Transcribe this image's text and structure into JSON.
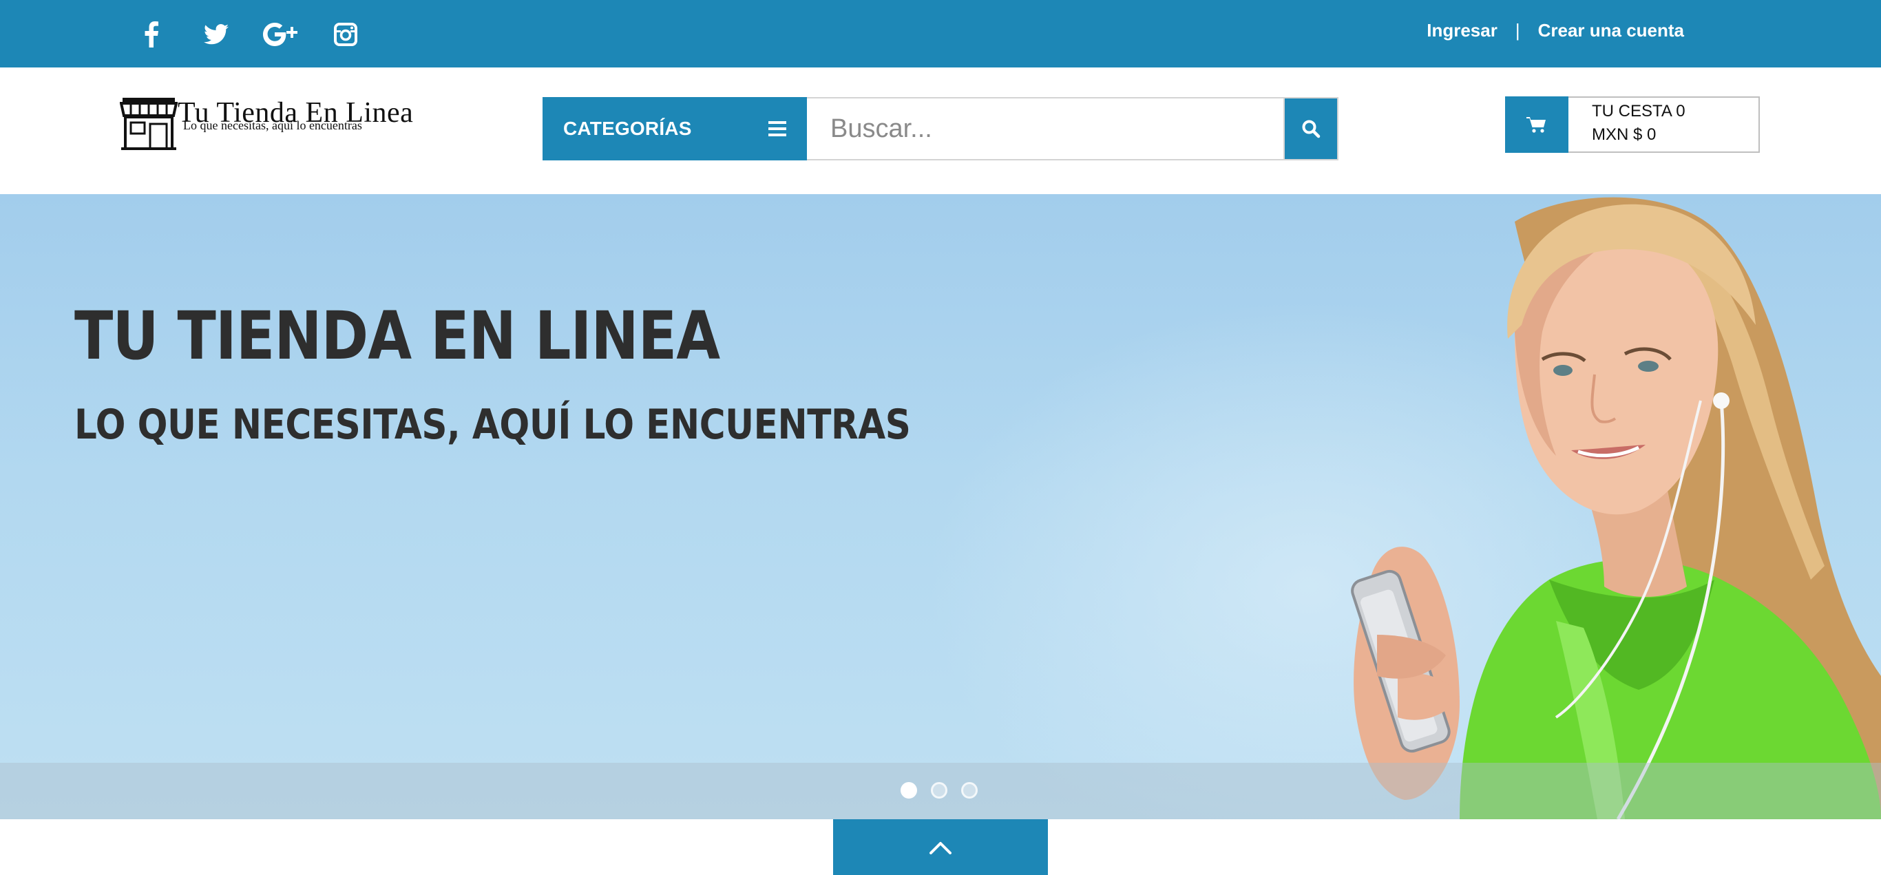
{
  "topbar": {
    "social": [
      {
        "name": "facebook-icon"
      },
      {
        "name": "twitter-icon"
      },
      {
        "name": "google-plus-icon"
      },
      {
        "name": "instagram-icon"
      }
    ],
    "login_label": "Ingresar",
    "separator": "|",
    "register_label": "Crear una cuenta"
  },
  "header": {
    "logo": {
      "name": "Tu Tienda En Linea",
      "tagline": "Lo que necesitas, aquí lo encuentras",
      "icon": "storefront-icon"
    },
    "categories_label": "CATEGORÍAS",
    "categories_icon": "menu-icon",
    "search": {
      "placeholder": "Buscar...",
      "value": "",
      "icon": "search-icon"
    },
    "cart": {
      "icon": "shopping-cart-icon",
      "line1": "TU CESTA 0",
      "line2": "MXN $ 0"
    }
  },
  "hero": {
    "title": "TU TIENDA EN LINEA",
    "subtitle": "LO QUE NECESITAS, AQUÍ LO ENCUENTRAS",
    "slides_count": 3,
    "active_slide": 1
  },
  "footer": {
    "scroll_top_icon": "chevron-up-icon"
  },
  "colors": {
    "brand": "#1d87b6",
    "text": "#2e2e2e",
    "hero_sky": "#a2cdec"
  }
}
